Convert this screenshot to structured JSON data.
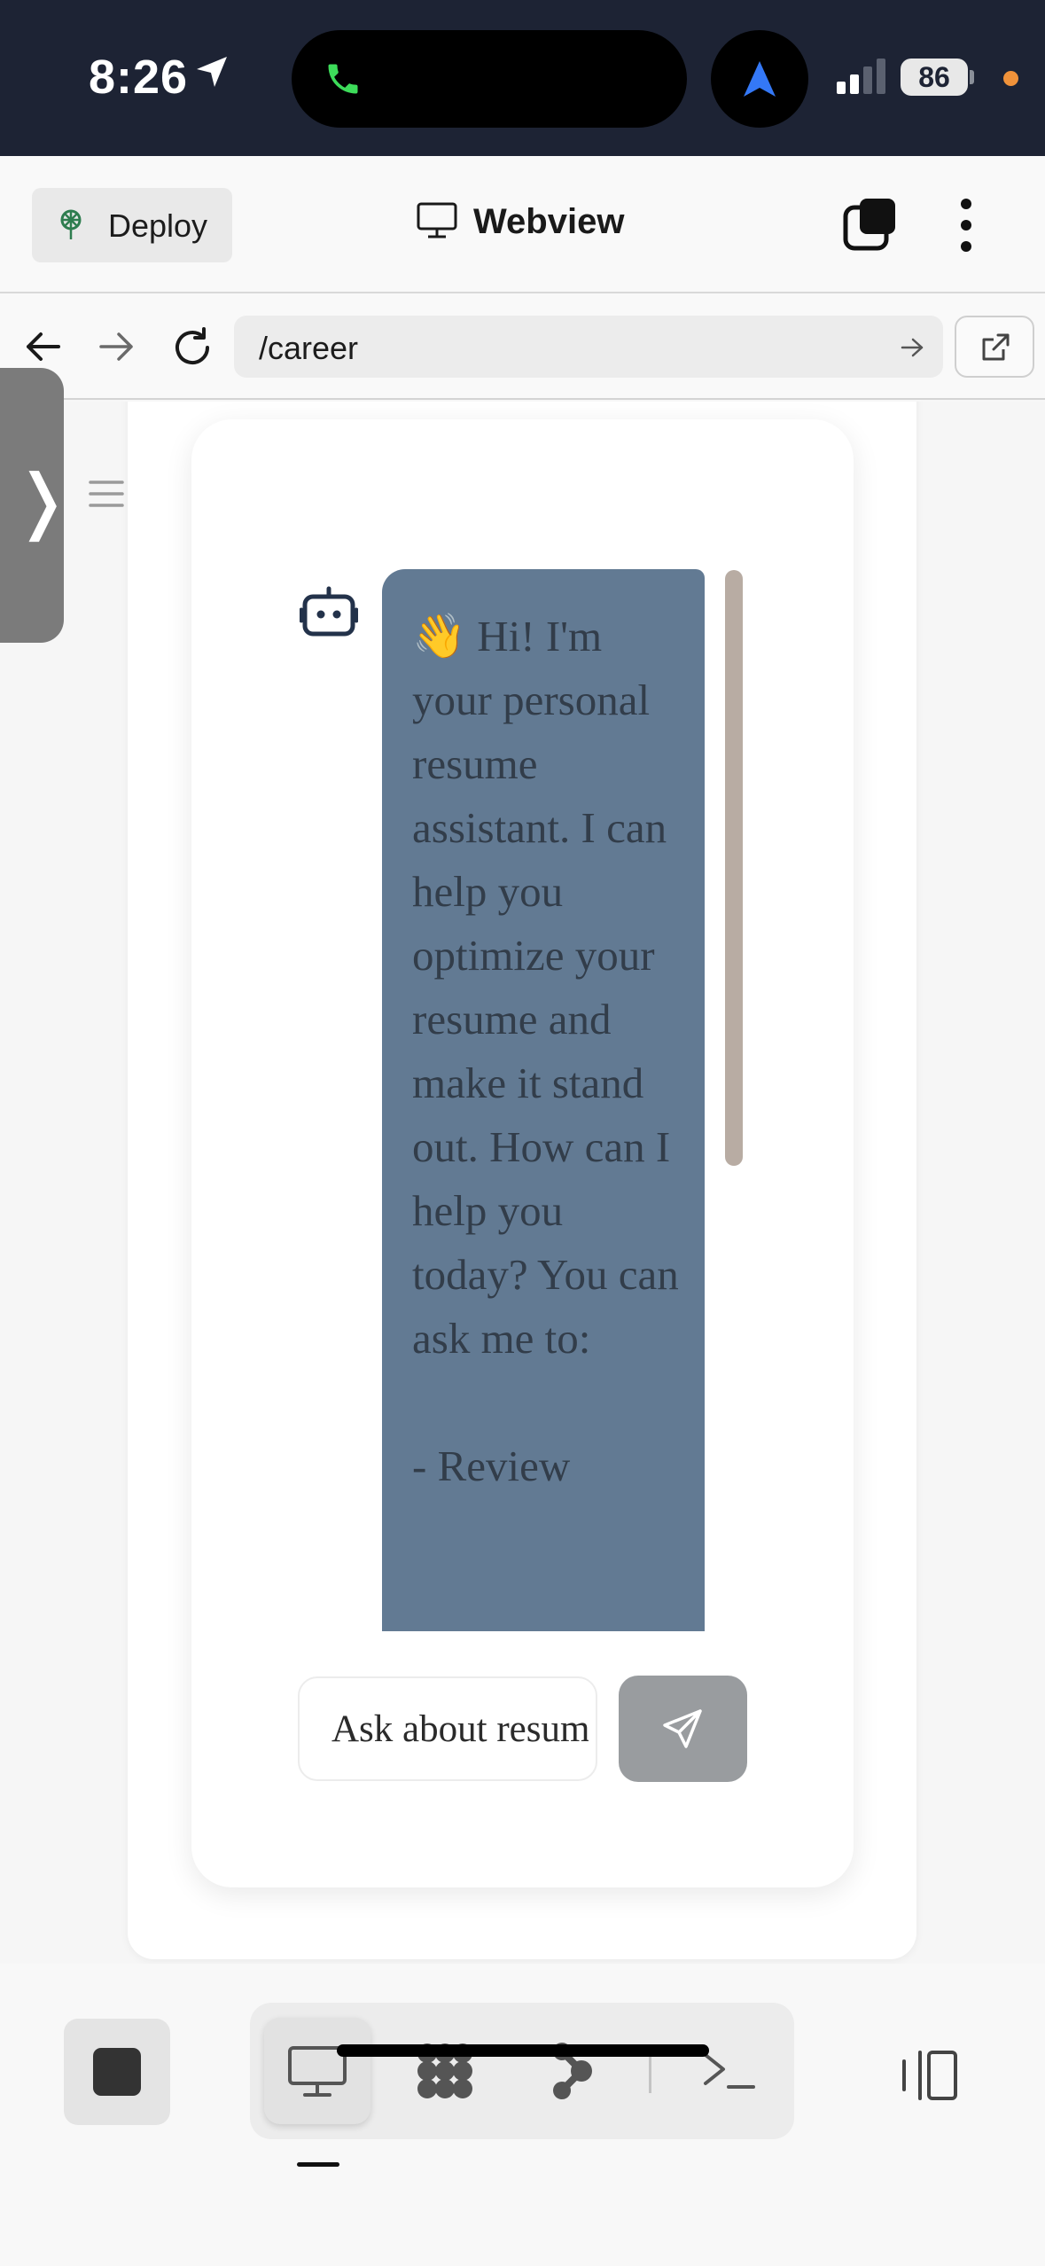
{
  "status_bar": {
    "time": "8:26",
    "battery": "86",
    "icons": [
      "location-arrow-icon",
      "phone-call-icon",
      "navigation-icon",
      "signal-icon",
      "battery-icon"
    ],
    "colors": {
      "background": "#1d2334",
      "call_green": "#3ddc5a",
      "nav_blue": "#3478f6",
      "privacy_dot": "#f0923a"
    }
  },
  "header": {
    "deploy_label": "Deploy",
    "title": "Webview"
  },
  "url_bar": {
    "url": "/career"
  },
  "chat": {
    "message": "👋 Hi! I'm your personal resume assistant. I can help you optimize your resume and make it stand out. How can I help you today? You can ask me to:\n\n- Review",
    "input_placeholder": "Ask about resume...",
    "colors": {
      "bubble": "#627a93",
      "bubble_text": "#323d4a",
      "send_button": "#999c9f"
    }
  },
  "side_handle": {
    "glyph": "❭"
  },
  "toolbar": {
    "tools": [
      "webview-tool",
      "packages-tool",
      "git-tool",
      "terminal-tool"
    ],
    "active_tool": "webview-tool"
  }
}
